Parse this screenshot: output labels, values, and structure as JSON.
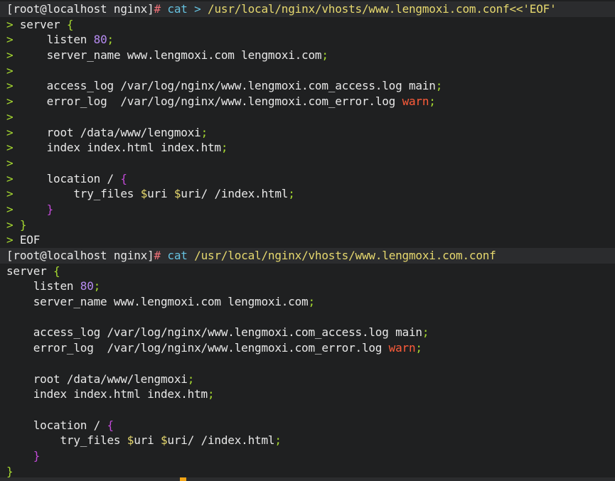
{
  "terminal": {
    "theme": {
      "background": "#1f2021",
      "prompt_line_background": "#2b2c2e",
      "default_text": "#e8e8e8",
      "continuation_prompt": "#a6d930",
      "prompt_hash": "#f07178",
      "command": "#66c2e0",
      "path": "#e6d86e",
      "brace": "#c24ad8",
      "number": "#b78cf2",
      "variable": "#e6d86e",
      "warn": "#ff5c3a",
      "cursor": "#f2a516"
    },
    "lines": [
      {
        "type": "prompt",
        "segments": [
          [
            "t-white",
            "[root@localhost nginx]"
          ],
          [
            "t-hash",
            "# "
          ],
          [
            "t-cmd",
            "cat "
          ],
          [
            "t-cmd",
            "> "
          ],
          [
            "t-path",
            "/usr/local/nginx/vhosts/www.lengmoxi.com.conf<<'EOF'"
          ]
        ]
      },
      {
        "segments": [
          [
            "t-cont",
            "> "
          ],
          [
            "t-white",
            "server "
          ],
          [
            "t-green",
            "{"
          ]
        ]
      },
      {
        "segments": [
          [
            "t-cont",
            ">     "
          ],
          [
            "t-white",
            "listen "
          ],
          [
            "t-num",
            "80"
          ],
          [
            "t-green",
            ";"
          ]
        ]
      },
      {
        "segments": [
          [
            "t-cont",
            ">     "
          ],
          [
            "t-white",
            "server_name www.lengmoxi.com lengmoxi.com"
          ],
          [
            "t-green",
            ";"
          ]
        ]
      },
      {
        "segments": [
          [
            "t-cont",
            ">"
          ]
        ]
      },
      {
        "segments": [
          [
            "t-cont",
            ">     "
          ],
          [
            "t-white",
            "access_log /var/log/nginx/www.lengmoxi.com_access.log main"
          ],
          [
            "t-green",
            ";"
          ]
        ]
      },
      {
        "segments": [
          [
            "t-cont",
            ">     "
          ],
          [
            "t-white",
            "error_log  /var/log/nginx/www.lengmoxi.com_error.log "
          ],
          [
            "t-warn",
            "warn"
          ],
          [
            "t-green",
            ";"
          ]
        ]
      },
      {
        "segments": [
          [
            "t-cont",
            ">"
          ]
        ]
      },
      {
        "segments": [
          [
            "t-cont",
            ">     "
          ],
          [
            "t-white",
            "root /data/www/lengmoxi"
          ],
          [
            "t-green",
            ";"
          ]
        ]
      },
      {
        "segments": [
          [
            "t-cont",
            ">     "
          ],
          [
            "t-white",
            "index index.html index.htm"
          ],
          [
            "t-green",
            ";"
          ]
        ]
      },
      {
        "segments": [
          [
            "t-cont",
            ">"
          ]
        ]
      },
      {
        "segments": [
          [
            "t-cont",
            ">     "
          ],
          [
            "t-white",
            "location / "
          ],
          [
            "t-brace",
            "{"
          ]
        ]
      },
      {
        "segments": [
          [
            "t-cont",
            ">         "
          ],
          [
            "t-white",
            "try_files "
          ],
          [
            "t-var",
            "$"
          ],
          [
            "t-white",
            "uri "
          ],
          [
            "t-var",
            "$"
          ],
          [
            "t-white",
            "uri/ /index.html"
          ],
          [
            "t-green",
            ";"
          ]
        ]
      },
      {
        "segments": [
          [
            "t-cont",
            ">     "
          ],
          [
            "t-brace",
            "}"
          ]
        ]
      },
      {
        "segments": [
          [
            "t-cont",
            "> "
          ],
          [
            "t-green",
            "}"
          ]
        ]
      },
      {
        "segments": [
          [
            "t-cont",
            "> "
          ],
          [
            "t-white",
            "EOF"
          ]
        ]
      },
      {
        "type": "prompt",
        "segments": [
          [
            "t-white",
            "[root@localhost nginx]"
          ],
          [
            "t-hash",
            "# "
          ],
          [
            "t-cmd",
            "cat "
          ],
          [
            "t-path",
            "/usr/local/nginx/vhosts/www.lengmoxi.com.conf"
          ]
        ]
      },
      {
        "segments": [
          [
            "t-white",
            "server "
          ],
          [
            "t-green",
            "{"
          ]
        ]
      },
      {
        "segments": [
          [
            "t-white",
            "    listen "
          ],
          [
            "t-num",
            "80"
          ],
          [
            "t-green",
            ";"
          ]
        ]
      },
      {
        "segments": [
          [
            "t-white",
            "    server_name www.lengmoxi.com lengmoxi.com"
          ],
          [
            "t-green",
            ";"
          ]
        ]
      },
      {
        "segments": []
      },
      {
        "segments": [
          [
            "t-white",
            "    access_log /var/log/nginx/www.lengmoxi.com_access.log main"
          ],
          [
            "t-green",
            ";"
          ]
        ]
      },
      {
        "segments": [
          [
            "t-white",
            "    error_log  /var/log/nginx/www.lengmoxi.com_error.log "
          ],
          [
            "t-warn",
            "warn"
          ],
          [
            "t-green",
            ";"
          ]
        ]
      },
      {
        "segments": []
      },
      {
        "segments": [
          [
            "t-white",
            "    root /data/www/lengmoxi"
          ],
          [
            "t-green",
            ";"
          ]
        ]
      },
      {
        "segments": [
          [
            "t-white",
            "    index index.html index.htm"
          ],
          [
            "t-green",
            ";"
          ]
        ]
      },
      {
        "segments": []
      },
      {
        "segments": [
          [
            "t-white",
            "    location / "
          ],
          [
            "t-brace",
            "{"
          ]
        ]
      },
      {
        "segments": [
          [
            "t-white",
            "        try_files "
          ],
          [
            "t-var",
            "$"
          ],
          [
            "t-white",
            "uri "
          ],
          [
            "t-var",
            "$"
          ],
          [
            "t-white",
            "uri/ /index.html"
          ],
          [
            "t-green",
            ";"
          ]
        ]
      },
      {
        "segments": [
          [
            "t-white",
            "    "
          ],
          [
            "t-brace",
            "}"
          ]
        ]
      },
      {
        "segments": [
          [
            "t-green",
            "}"
          ]
        ]
      }
    ]
  }
}
